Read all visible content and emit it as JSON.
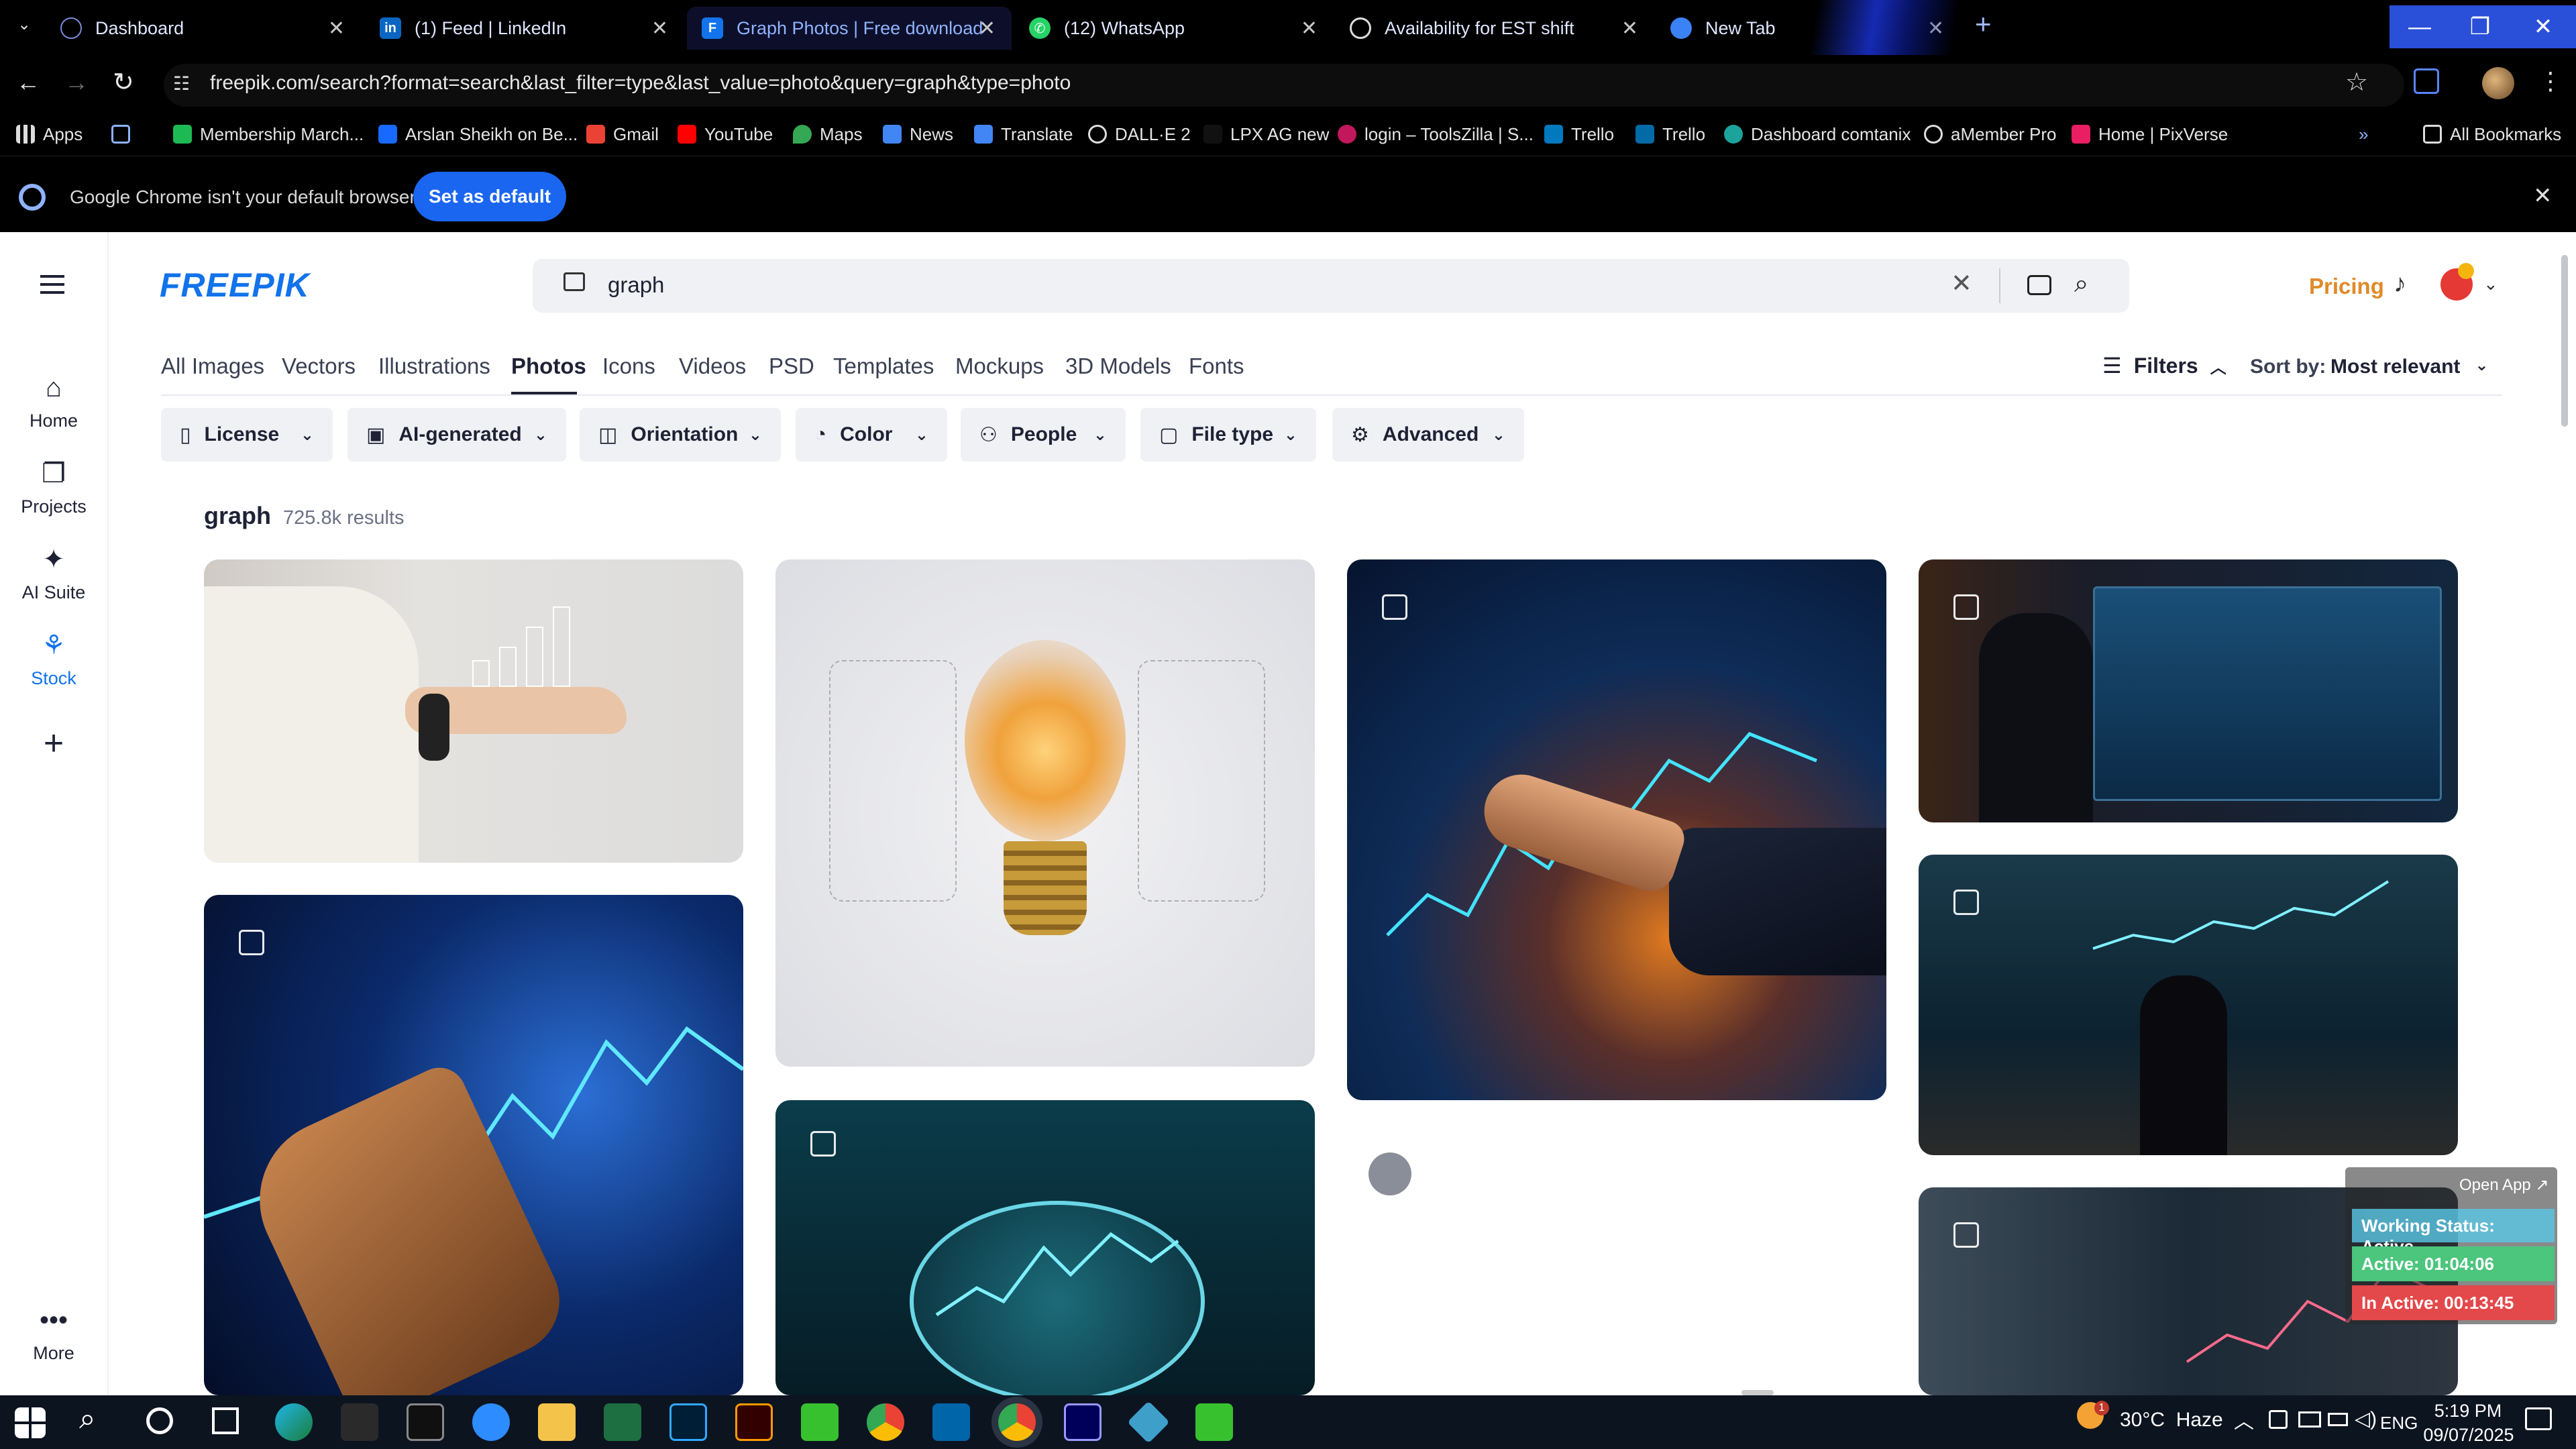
{
  "browser": {
    "tabs": [
      {
        "title": "Dashboard",
        "icon": "globe-icon"
      },
      {
        "title": "(1) Feed | LinkedIn",
        "icon": "linkedin-icon"
      },
      {
        "title": "Graph Photos | Free download",
        "icon": "freepik-icon"
      },
      {
        "title": "(12) WhatsApp",
        "icon": "whatsapp-icon"
      },
      {
        "title": "Availability for EST shift",
        "icon": "openai-icon"
      },
      {
        "title": "New Tab",
        "icon": "chrome-icon"
      }
    ],
    "url": "freepik.com/search?format=search&last_filter=type&last_value=photo&query=graph&type=photo",
    "bookmarks": [
      "Apps",
      "Membership March...",
      "Arslan Sheikh on Be...",
      "Gmail",
      "YouTube",
      "Maps",
      "News",
      "Translate",
      "DALL·E 2",
      "LPX AG new",
      "login – ToolsZilla | S...",
      "Trello",
      "Trello",
      "Dashboard comtanix",
      "aMember Pro",
      "Home | PixVerse"
    ],
    "all_bookmarks": "All Bookmarks",
    "infobar_text": "Google Chrome isn't your default browser",
    "infobar_button": "Set as default"
  },
  "site": {
    "logo": "FREEPIK",
    "search_value": "graph",
    "pricing": "Pricing",
    "nav": [
      {
        "label": "Home",
        "icon": "home-icon"
      },
      {
        "label": "Projects",
        "icon": "projects-icon"
      },
      {
        "label": "AI Suite",
        "icon": "sparkle-icon"
      },
      {
        "label": "Stock",
        "icon": "stock-icon"
      },
      {
        "label": "",
        "icon": "plus-icon"
      }
    ],
    "more_label": "More",
    "categories": [
      "All Images",
      "Vectors",
      "Illustrations",
      "Photos",
      "Icons",
      "Videos",
      "PSD",
      "Templates",
      "Mockups",
      "3D Models",
      "Fonts"
    ],
    "active_category": "Photos",
    "filters_label": "Filters",
    "sort_label": "Sort by:",
    "sort_value": "Most relevant",
    "chips": [
      {
        "label": "License",
        "icon": "license-icon"
      },
      {
        "label": "AI-generated",
        "icon": "ai-icon"
      },
      {
        "label": "Orientation",
        "icon": "orientation-icon"
      },
      {
        "label": "Color",
        "icon": "palette-icon"
      },
      {
        "label": "People",
        "icon": "people-icon"
      },
      {
        "label": "File type",
        "icon": "file-icon"
      },
      {
        "label": "Advanced",
        "icon": "settings-icon"
      }
    ],
    "results_query": "graph",
    "results_count": "725.8k results"
  },
  "tracker": {
    "open_app": "Open App ↗",
    "status": "Working Status: Active",
    "active": "Active: 01:04:06",
    "inactive": "In Active: 00:13:45"
  },
  "taskbar": {
    "weather": "30°C  Haze",
    "lang": "ENG",
    "time": "5:19 PM",
    "date": "09/07/2025",
    "notif_count": "1"
  },
  "colors": {
    "brand": "#1273eb",
    "pricing": "#e08a2a",
    "tracker_green": "#4cc57d",
    "tracker_red": "#e3484a"
  }
}
